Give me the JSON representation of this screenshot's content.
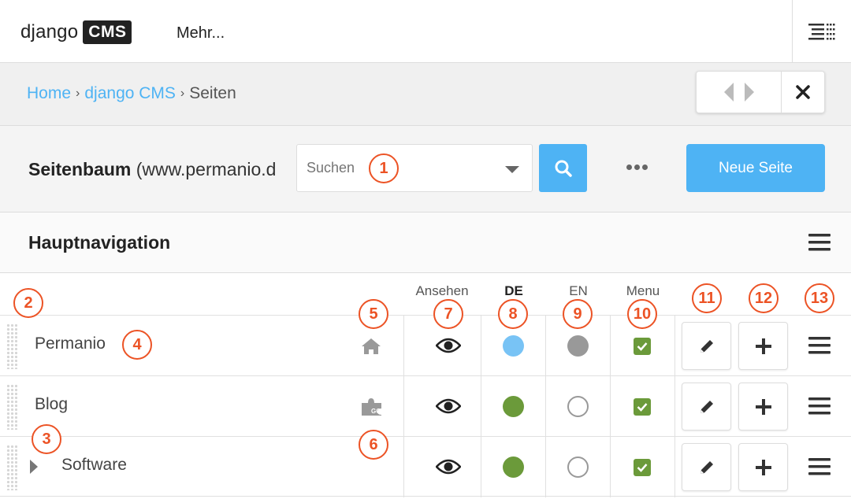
{
  "toolbar": {
    "logo_text": "django",
    "logo_box": "CMS",
    "more_label": "Mehr..."
  },
  "breadcrumb": {
    "items": [
      "Home",
      "django CMS",
      "Seiten"
    ],
    "separator": "›"
  },
  "header": {
    "title": "Seitenbaum",
    "site": "(www.permanio.d",
    "search_placeholder": "Suchen",
    "new_page_label": "Neue Seite"
  },
  "menu": {
    "title": "Hauptnavigation"
  },
  "columns": {
    "view": "Ansehen",
    "lang_de": "DE",
    "lang_en": "EN",
    "menu": "Menu"
  },
  "rows": [
    {
      "title": "Permanio",
      "icon": "home-icon",
      "de_status": "published-current",
      "en_status": "published",
      "in_menu": true,
      "expandable": false
    },
    {
      "title": "Blog",
      "icon": "apphook-icon",
      "de_status": "published",
      "en_status": "empty",
      "in_menu": true,
      "expandable": false
    },
    {
      "title": "Software",
      "icon": "",
      "de_status": "published",
      "en_status": "empty",
      "in_menu": true,
      "expandable": true
    }
  ],
  "colors": {
    "accent": "#4eb3f4",
    "published": "#6b9a3a",
    "current": "#78c3f5",
    "unpublished": "#999999",
    "callout": "#ec5325"
  },
  "callouts": [
    "1",
    "2",
    "3",
    "4",
    "5",
    "6",
    "7",
    "8",
    "9",
    "10",
    "11",
    "12",
    "13"
  ]
}
